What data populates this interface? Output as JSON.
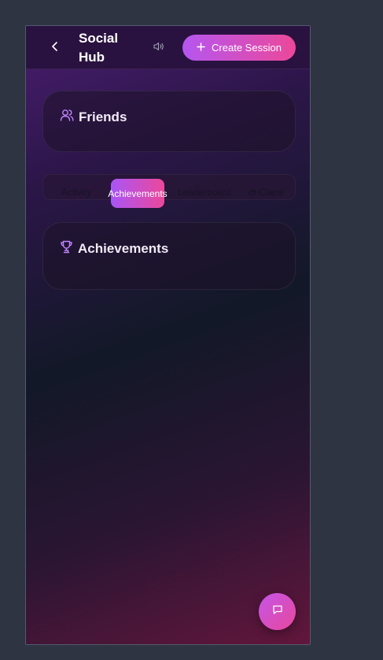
{
  "header": {
    "title": "Social Hub",
    "back_icon": "chevron-left-icon",
    "sound_icon": "volume-icon",
    "create_label": "Create Session",
    "create_icon": "plus-icon"
  },
  "friends_card": {
    "title": "Friends",
    "icon": "users-icon"
  },
  "tabs": [
    {
      "label": "Activity",
      "active": false
    },
    {
      "label": "Achievements",
      "active": true
    },
    {
      "label": "Leaderboard",
      "active": false
    },
    {
      "label": "Clans",
      "active": false,
      "icon": "crown-icon"
    }
  ],
  "achievements_card": {
    "title": "Achievements",
    "icon": "trophy-icon"
  },
  "fab": {
    "icon": "chat-icon"
  },
  "colors": {
    "accent_start": "#a855f7",
    "accent_end": "#ec4899",
    "background": "#2e3442"
  }
}
